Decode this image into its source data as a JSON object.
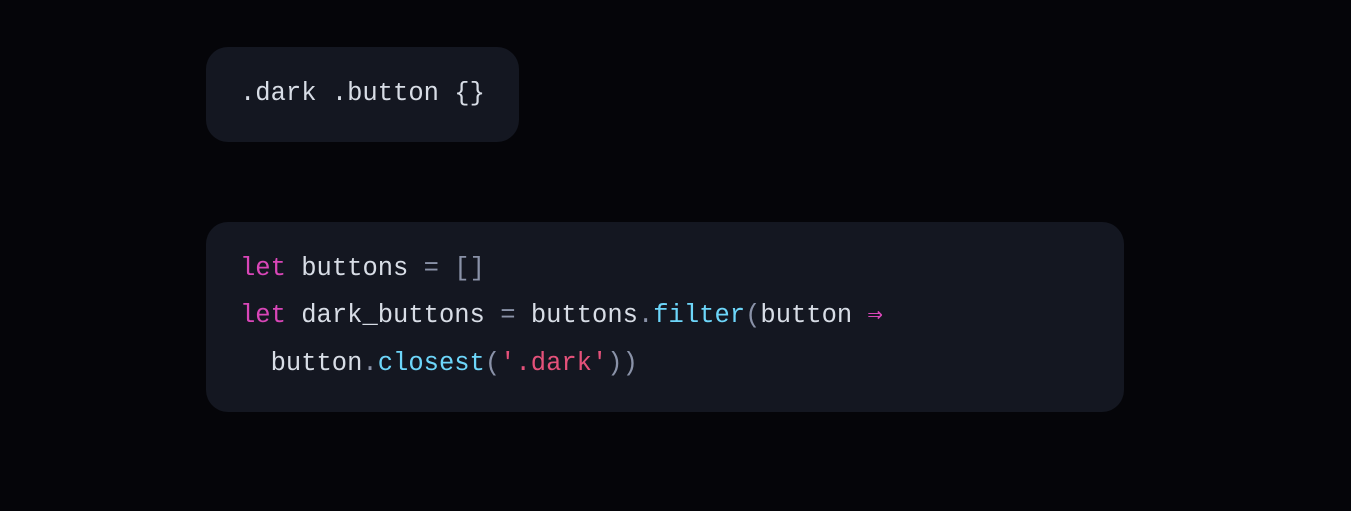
{
  "colors": {
    "background": "#050509",
    "panel": "#141721",
    "default": "#d8dde6",
    "keyword": "#d946b8",
    "func": "#6dd6fa",
    "punct": "#8a92a8",
    "string": "#e4517a"
  },
  "css_block": {
    "sel_dark": ".dark",
    "sel_button": ".button",
    "open_brace": "{",
    "close_brace": "}"
  },
  "js_block": {
    "kw_let": "let",
    "id_buttons": "buttons",
    "eq": "=",
    "lbracket": "[",
    "rbracket": "]",
    "id_dark_buttons": "dark_buttons",
    "dot": ".",
    "fn_filter": "filter",
    "lparen": "(",
    "id_button": "button",
    "arrow": "⇒",
    "fn_closest": "closest",
    "str_dark": "'.dark'",
    "rparen": ")"
  }
}
